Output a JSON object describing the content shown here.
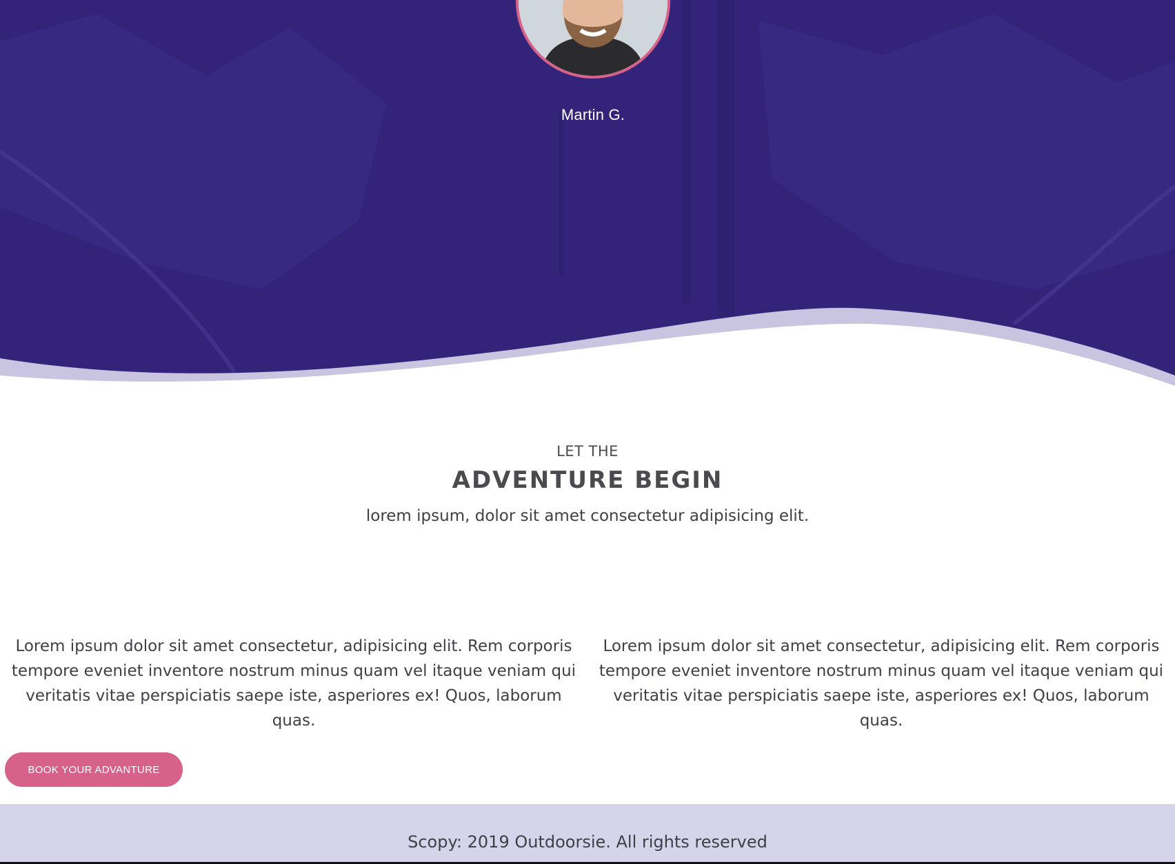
{
  "hero": {
    "name": "Martin G."
  },
  "intro": {
    "eyebrow": "LET THE",
    "headline": "ADVENTURE BEGIN",
    "tagline": "lorem ipsum, dolor sit amet consectetur adipisicing elit."
  },
  "columns": [
    {
      "text": "Lorem ipsum dolor sit amet consectetur, adipisicing elit. Rem corporis tempore eveniet inventore nostrum minus quam vel itaque veniam qui veritatis vitae perspiciatis saepe iste, asperiores ex! Quos, laborum quas."
    },
    {
      "text": "Lorem ipsum dolor sit amet consectetur, adipisicing elit. Rem corporis tempore eveniet inventore nostrum minus quam vel itaque veniam qui veritatis vitae perspiciatis saepe iste, asperiores ex! Quos, laborum quas."
    }
  ],
  "cta": {
    "label": "BOOK YOUR ADVANTURE"
  },
  "footer": {
    "text": "Scopy: 2019 Outdoorsie. All rights reserved"
  },
  "colors": {
    "hero_purple": "#33247a",
    "accent_pink": "#d6628a",
    "footer_lavender": "#d6d4ea",
    "text_dark": "#3f3f46"
  }
}
